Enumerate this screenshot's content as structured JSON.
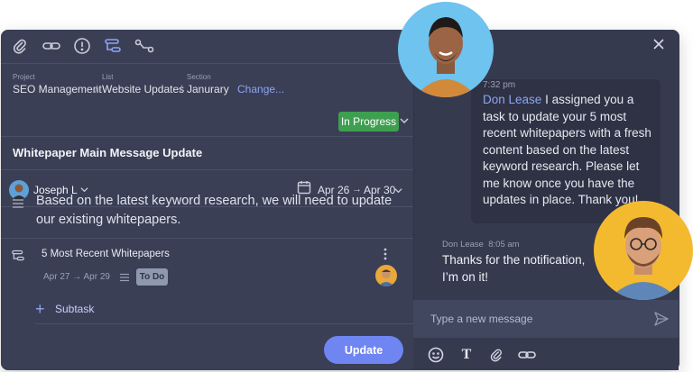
{
  "toolbar": {
    "icons": [
      "paperclip-icon",
      "link-icon",
      "alert-icon",
      "subtasks-icon",
      "dependency-icon"
    ]
  },
  "breadcrumb": {
    "project_label": "Project",
    "project": "SEO Management",
    "list_label": "List",
    "list": "Website Updates",
    "section_label": "Section",
    "section": "Janurary",
    "change_link": "Change..."
  },
  "task": {
    "title": "Whitepaper Main Message Update",
    "status": "In Progress",
    "status_color": "#3f9f50",
    "assignee": "Joseph L",
    "start_date": "Apr 26",
    "end_date": "Apr 30",
    "date_arrow": "→",
    "description": "Based on the latest keyword research, we will need to update our existing whitepapers."
  },
  "subtask": {
    "title": "5 Most Recent Whitepapers",
    "start_date": "Apr 27",
    "end_date": "Apr 29",
    "status": "To Do",
    "add_label": "Subtask"
  },
  "actions": {
    "update_label": "Update",
    "accent": "#6f85f2"
  },
  "chat": {
    "message1": {
      "time": "7:32 pm",
      "mention": "Don Lease",
      "text": " I assigned you a task to update your 5 most recent whitepapers with a fresh content based on the latest keyword research.  Please let me know once you have the updates in place. Thank you!"
    },
    "message2": {
      "author": "Don Lease",
      "time": "8:05 am",
      "text": "Thanks for the notification, I’m on it!"
    },
    "input_placeholder": "Type a new message",
    "format_icons": [
      "emoji-icon",
      "text-format-icon",
      "attach-icon",
      "link-icon"
    ],
    "text_format_glyph": "T"
  }
}
